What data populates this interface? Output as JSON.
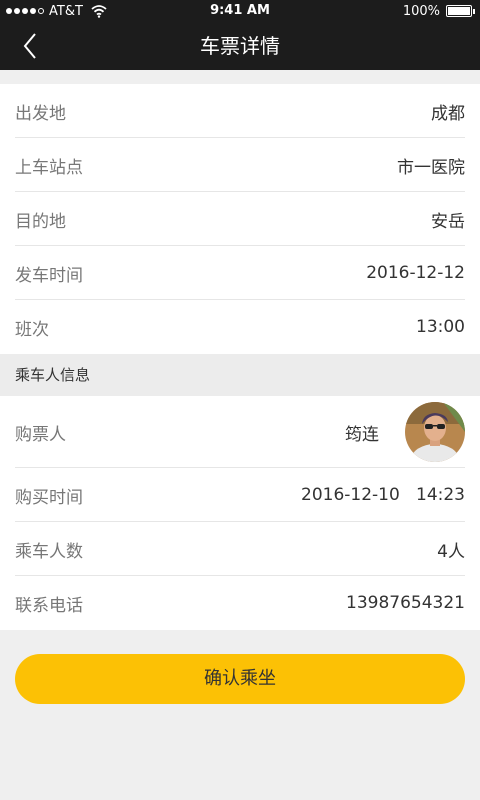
{
  "status_bar": {
    "carrier": "AT&T",
    "time": "9:41 AM",
    "battery": "100%"
  },
  "header": {
    "title": "车票详情",
    "back_icon": "chevron-left-icon"
  },
  "trip": {
    "origin_label": "出发地",
    "origin_value": "成都",
    "station_label": "上车站点",
    "station_value": "市一医院",
    "destination_label": "目的地",
    "destination_value": "安岳",
    "departure_label": "发车时间",
    "departure_value": "2016-12-12",
    "schedule_label": "班次",
    "schedule_value": "13:00"
  },
  "passenger_section": {
    "header": "乘车人信息",
    "buyer_label": "购票人",
    "buyer_value": "筠连",
    "purchase_time_label": "购买时间",
    "purchase_time_value": "2016-12-10   14:23",
    "count_label": "乘车人数",
    "count_value": "4人",
    "phone_label": "联系电话",
    "phone_value": "13987654321"
  },
  "confirm_button": "确认乘坐",
  "colors": {
    "nav_bg": "#1c1c1c",
    "accent": "#fcc105",
    "page_bg": "#efefef"
  }
}
